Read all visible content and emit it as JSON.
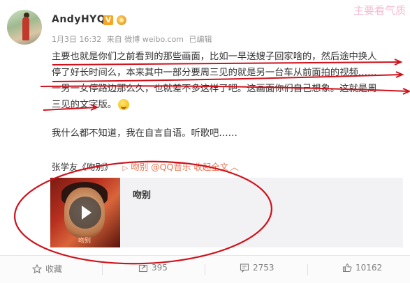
{
  "post": {
    "username": "AndyHYQ",
    "verified_badge": "V",
    "meta": {
      "date": "1月3日 16:32",
      "source": "来自 微博 weibo.com",
      "edited": "已编辑"
    },
    "watermark": "主要看气质",
    "content_lines": [
      "主要也就是你们之前看到的那些画面，比如一早送嫂子回家啥的，然后途中换人",
      "停了好长时间么，本来其中一部分要周三见的就是另一台车从前面拍的视频……",
      "一男一女停路边那么久，也就差不多这样了吧。这画面你们自己想象。这就是周",
      "三见的文字版。"
    ],
    "paragraph2": "我什么都不知道，我在自言自语。听歌吧……",
    "song_line": {
      "artist_song": "张学友《吻别》",
      "link": "吻别 @QQ音乐 收起全文"
    },
    "card": {
      "title": "吻别",
      "cover_text": "吻别"
    },
    "actions": [
      {
        "icon": "star-icon",
        "label": "收藏"
      },
      {
        "icon": "share-icon",
        "label": "395"
      },
      {
        "icon": "comment-icon",
        "label": "2753"
      },
      {
        "icon": "like-icon",
        "label": "10162"
      }
    ]
  },
  "colors": {
    "accent": "#eb7350",
    "annotation": "#d0111b",
    "muted": "#999999"
  }
}
